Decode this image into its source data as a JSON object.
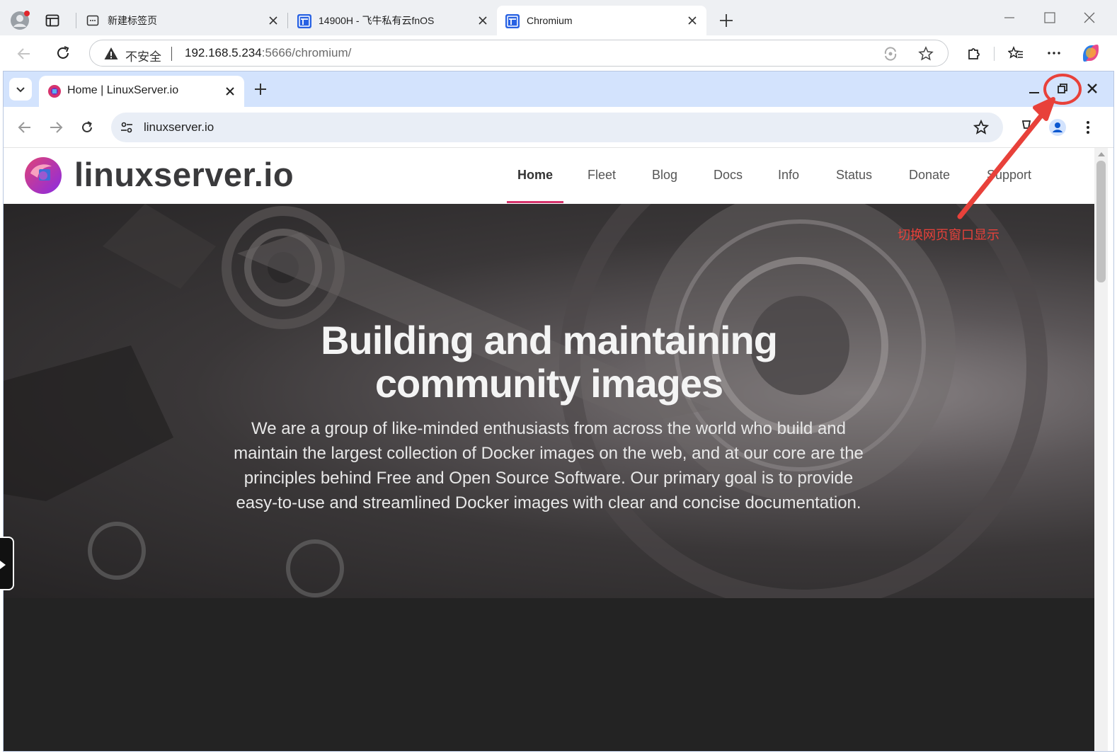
{
  "outer_browser": {
    "tabs": [
      {
        "title": "新建标签页"
      },
      {
        "title": "14900H - 飞牛私有云fnOS"
      },
      {
        "title": "Chromium"
      }
    ],
    "address": {
      "security_label": "不安全",
      "url_host": "192.168.5.234",
      "url_rest": ":5666/chromium/"
    }
  },
  "inner_browser": {
    "tab": {
      "title": "Home | LinuxServer.io"
    },
    "address": {
      "url": "linuxserver.io"
    }
  },
  "site": {
    "logo_text": "linuxserver.io",
    "nav": [
      "Home",
      "Fleet",
      "Blog",
      "Docs",
      "Info",
      "Status",
      "Donate",
      "Support"
    ],
    "active_nav": "Home",
    "hero": {
      "title_line1": "Building and maintaining",
      "title_line2": "community images",
      "body_line1": "We are a group of like-minded enthusiasts from across the world who build and",
      "body_line2": "maintain the largest collection of Docker images on the web, and at our core are the",
      "body_line3": "principles behind Free and Open Source Software. Our primary goal is to provide",
      "body_line4": "easy-to-use and streamlined Docker images with clear and concise documentation."
    }
  },
  "annotation": {
    "text": "切换网页窗口显示",
    "color": "#e8413a"
  },
  "colors": {
    "accent": "#d6336c",
    "inner_tabstrip": "#d3e3fd"
  }
}
